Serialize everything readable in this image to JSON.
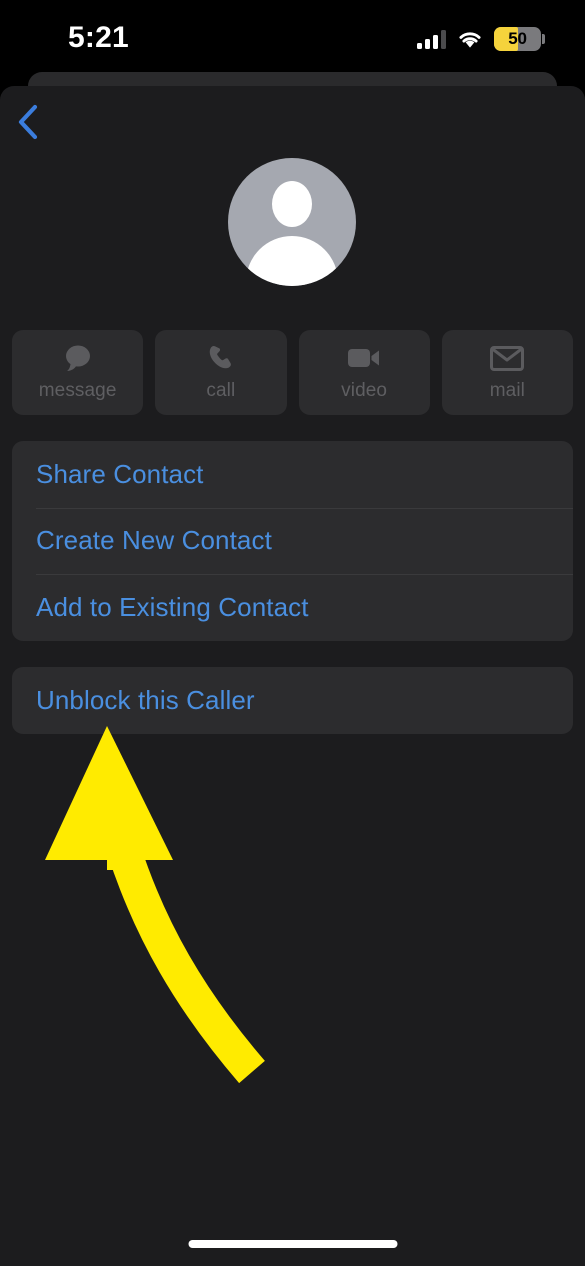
{
  "status_bar": {
    "time": "5:21",
    "signal_icon": "cellular-signal-icon",
    "wifi_icon": "wifi-icon",
    "battery_percent": "50",
    "battery_fill_color": "#f5d33c",
    "battery_low_power_mode": true
  },
  "navigation": {
    "back_icon": "chevron-left-icon",
    "back_accent_color": "#3b7ddd"
  },
  "contact": {
    "avatar_icon": "person-placeholder-icon",
    "avatar_background_color": "#a5a8b0"
  },
  "quick_actions": [
    {
      "id": "message",
      "label": "message",
      "icon": "message-bubble-icon",
      "enabled": false
    },
    {
      "id": "call",
      "label": "call",
      "icon": "phone-handset-icon",
      "enabled": false
    },
    {
      "id": "video",
      "label": "video",
      "icon": "video-camera-icon",
      "enabled": false
    },
    {
      "id": "mail",
      "label": "mail",
      "icon": "envelope-icon",
      "enabled": false
    }
  ],
  "contact_actions": {
    "rows": [
      {
        "label": "Share Contact"
      },
      {
        "label": "Create New Contact"
      },
      {
        "label": "Add to Existing Contact"
      }
    ]
  },
  "block_actions": {
    "rows": [
      {
        "label": "Unblock this Caller"
      }
    ]
  },
  "theme": {
    "page_background": "#1c1c1e",
    "card_background": "#2c2c2e",
    "link_blue": "#4a8fe0",
    "separator": "#3a3a3c",
    "disabled_text": "#5f5f62"
  },
  "annotation": {
    "arrow_icon": "curved-up-arrow-annotation",
    "arrow_color": "#ffeb00",
    "points_to": "Unblock this Caller"
  },
  "home_indicator": {
    "icon": "home-indicator-bar"
  }
}
